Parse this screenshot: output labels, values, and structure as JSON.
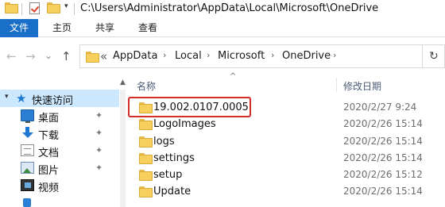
{
  "titlebar": {
    "path": "C:\\Users\\Administrator\\AppData\\Local\\Microsoft\\OneDrive",
    "dropdown_glyph": "▾"
  },
  "ribbon": {
    "tabs": [
      {
        "label": "文件"
      },
      {
        "label": "主页"
      },
      {
        "label": "共享"
      },
      {
        "label": "查看"
      }
    ]
  },
  "address": {
    "overflow": "«",
    "crumbs": [
      "AppData",
      "Local",
      "Microsoft",
      "OneDrive"
    ],
    "separator": "›"
  },
  "nav_buttons": {
    "back": "←",
    "forward": "→",
    "recent": "⌄",
    "up": "↑",
    "refresh": "↻"
  },
  "navpane": {
    "quick_access": {
      "label": "快速访问",
      "caret": "▾",
      "icon": "star-icon"
    },
    "items": [
      {
        "label": "桌面",
        "icon": "desktop-icon",
        "pinned": true
      },
      {
        "label": "下载",
        "icon": "download-icon",
        "pinned": true
      },
      {
        "label": "文档",
        "icon": "documents-icon",
        "pinned": true
      },
      {
        "label": "图片",
        "icon": "pictures-icon",
        "pinned": true
      },
      {
        "label": "视频",
        "icon": "videos-icon",
        "pinned": false
      },
      {
        "label": "",
        "icon": "music-icon",
        "pinned": false
      }
    ],
    "pin_glyph": "📌"
  },
  "filelist": {
    "columns": {
      "name": "名称",
      "date": "修改日期"
    },
    "sort_glyph": "^",
    "rows": [
      {
        "name": "19.002.0107.0005",
        "date": "2020/2/27 9:24",
        "highlighted": true
      },
      {
        "name": "LogoImages",
        "date": "2020/2/26 15:14"
      },
      {
        "name": "logs",
        "date": "2020/2/26 15:14"
      },
      {
        "name": "settings",
        "date": "2020/2/26 15:14"
      },
      {
        "name": "setup",
        "date": "2020/2/26 15:12"
      },
      {
        "name": "Update",
        "date": "2020/2/26 15:14"
      }
    ]
  },
  "colors": {
    "file_tab": "#1a6fc9",
    "quick_access_bg": "#cce8ff",
    "highlight": "#d42b2b",
    "folder": "#f6cf5c"
  }
}
